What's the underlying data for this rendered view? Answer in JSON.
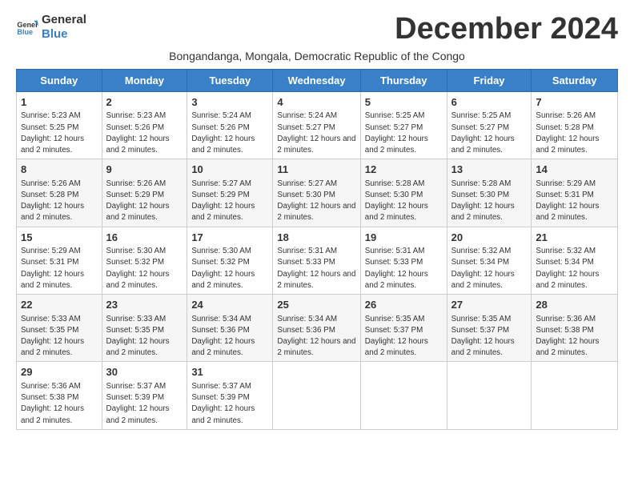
{
  "logo": {
    "text_general": "General",
    "text_blue": "Blue"
  },
  "month_title": "December 2024",
  "subtitle": "Bongandanga, Mongala, Democratic Republic of the Congo",
  "days_of_week": [
    "Sunday",
    "Monday",
    "Tuesday",
    "Wednesday",
    "Thursday",
    "Friday",
    "Saturday"
  ],
  "weeks": [
    [
      {
        "day": 1,
        "sunrise": "5:23 AM",
        "sunset": "5:25 PM",
        "daylight": "12 hours and 2 minutes."
      },
      {
        "day": 2,
        "sunrise": "5:23 AM",
        "sunset": "5:26 PM",
        "daylight": "12 hours and 2 minutes."
      },
      {
        "day": 3,
        "sunrise": "5:24 AM",
        "sunset": "5:26 PM",
        "daylight": "12 hours and 2 minutes."
      },
      {
        "day": 4,
        "sunrise": "5:24 AM",
        "sunset": "5:27 PM",
        "daylight": "12 hours and 2 minutes."
      },
      {
        "day": 5,
        "sunrise": "5:25 AM",
        "sunset": "5:27 PM",
        "daylight": "12 hours and 2 minutes."
      },
      {
        "day": 6,
        "sunrise": "5:25 AM",
        "sunset": "5:27 PM",
        "daylight": "12 hours and 2 minutes."
      },
      {
        "day": 7,
        "sunrise": "5:26 AM",
        "sunset": "5:28 PM",
        "daylight": "12 hours and 2 minutes."
      }
    ],
    [
      {
        "day": 8,
        "sunrise": "5:26 AM",
        "sunset": "5:28 PM",
        "daylight": "12 hours and 2 minutes."
      },
      {
        "day": 9,
        "sunrise": "5:26 AM",
        "sunset": "5:29 PM",
        "daylight": "12 hours and 2 minutes."
      },
      {
        "day": 10,
        "sunrise": "5:27 AM",
        "sunset": "5:29 PM",
        "daylight": "12 hours and 2 minutes."
      },
      {
        "day": 11,
        "sunrise": "5:27 AM",
        "sunset": "5:30 PM",
        "daylight": "12 hours and 2 minutes."
      },
      {
        "day": 12,
        "sunrise": "5:28 AM",
        "sunset": "5:30 PM",
        "daylight": "12 hours and 2 minutes."
      },
      {
        "day": 13,
        "sunrise": "5:28 AM",
        "sunset": "5:30 PM",
        "daylight": "12 hours and 2 minutes."
      },
      {
        "day": 14,
        "sunrise": "5:29 AM",
        "sunset": "5:31 PM",
        "daylight": "12 hours and 2 minutes."
      }
    ],
    [
      {
        "day": 15,
        "sunrise": "5:29 AM",
        "sunset": "5:31 PM",
        "daylight": "12 hours and 2 minutes."
      },
      {
        "day": 16,
        "sunrise": "5:30 AM",
        "sunset": "5:32 PM",
        "daylight": "12 hours and 2 minutes."
      },
      {
        "day": 17,
        "sunrise": "5:30 AM",
        "sunset": "5:32 PM",
        "daylight": "12 hours and 2 minutes."
      },
      {
        "day": 18,
        "sunrise": "5:31 AM",
        "sunset": "5:33 PM",
        "daylight": "12 hours and 2 minutes."
      },
      {
        "day": 19,
        "sunrise": "5:31 AM",
        "sunset": "5:33 PM",
        "daylight": "12 hours and 2 minutes."
      },
      {
        "day": 20,
        "sunrise": "5:32 AM",
        "sunset": "5:34 PM",
        "daylight": "12 hours and 2 minutes."
      },
      {
        "day": 21,
        "sunrise": "5:32 AM",
        "sunset": "5:34 PM",
        "daylight": "12 hours and 2 minutes."
      }
    ],
    [
      {
        "day": 22,
        "sunrise": "5:33 AM",
        "sunset": "5:35 PM",
        "daylight": "12 hours and 2 minutes."
      },
      {
        "day": 23,
        "sunrise": "5:33 AM",
        "sunset": "5:35 PM",
        "daylight": "12 hours and 2 minutes."
      },
      {
        "day": 24,
        "sunrise": "5:34 AM",
        "sunset": "5:36 PM",
        "daylight": "12 hours and 2 minutes."
      },
      {
        "day": 25,
        "sunrise": "5:34 AM",
        "sunset": "5:36 PM",
        "daylight": "12 hours and 2 minutes."
      },
      {
        "day": 26,
        "sunrise": "5:35 AM",
        "sunset": "5:37 PM",
        "daylight": "12 hours and 2 minutes."
      },
      {
        "day": 27,
        "sunrise": "5:35 AM",
        "sunset": "5:37 PM",
        "daylight": "12 hours and 2 minutes."
      },
      {
        "day": 28,
        "sunrise": "5:36 AM",
        "sunset": "5:38 PM",
        "daylight": "12 hours and 2 minutes."
      }
    ],
    [
      {
        "day": 29,
        "sunrise": "5:36 AM",
        "sunset": "5:38 PM",
        "daylight": "12 hours and 2 minutes."
      },
      {
        "day": 30,
        "sunrise": "5:37 AM",
        "sunset": "5:39 PM",
        "daylight": "12 hours and 2 minutes."
      },
      {
        "day": 31,
        "sunrise": "5:37 AM",
        "sunset": "5:39 PM",
        "daylight": "12 hours and 2 minutes."
      },
      null,
      null,
      null,
      null
    ]
  ]
}
